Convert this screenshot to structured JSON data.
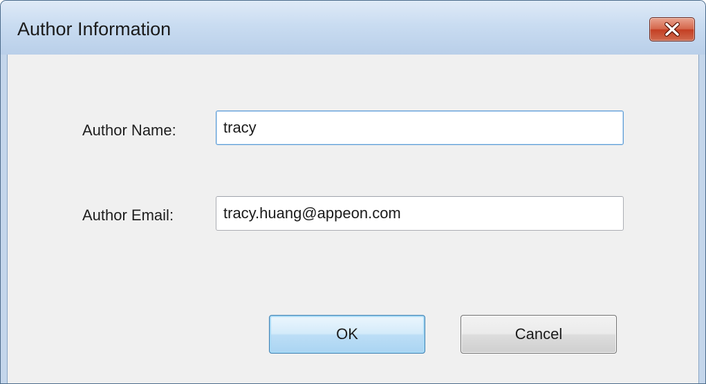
{
  "window": {
    "title": "Author Information",
    "close_icon": "close-icon"
  },
  "form": {
    "name_label": "Author Name:",
    "name_value": "tracy",
    "email_label": "Author Email:",
    "email_value": "tracy.huang@appeon.com"
  },
  "buttons": {
    "ok_label": "OK",
    "cancel_label": "Cancel"
  },
  "colors": {
    "titlebar": "#c9dcf1",
    "client": "#f0f0f0",
    "close_button": "#c43f23",
    "focus_border": "#5b9bd5"
  }
}
